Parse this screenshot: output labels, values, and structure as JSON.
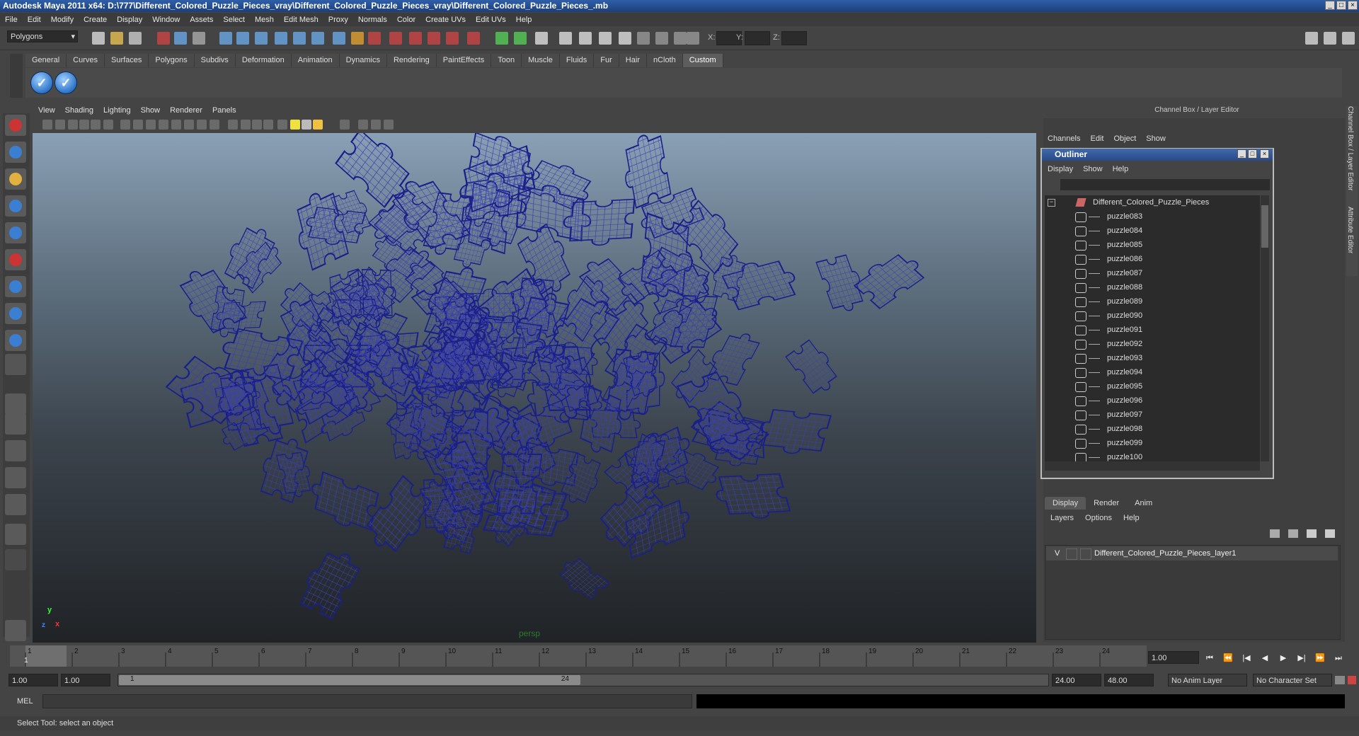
{
  "window": {
    "title": "Autodesk Maya 2011 x64: D:\\777\\Different_Colored_Puzzle_Pieces_vray\\Different_Colored_Puzzle_Pieces_vray\\Different_Colored_Puzzle_Pieces_.mb"
  },
  "menubar": [
    "File",
    "Edit",
    "Modify",
    "Create",
    "Display",
    "Window",
    "Assets",
    "Select",
    "Mesh",
    "Edit Mesh",
    "Proxy",
    "Normals",
    "Color",
    "Create UVs",
    "Edit UVs",
    "Help"
  ],
  "toolbar": {
    "mode_select": "Polygons",
    "coord_labels": [
      "X:",
      "Y:",
      "Z:"
    ]
  },
  "shelf": {
    "tabs": [
      "General",
      "Curves",
      "Surfaces",
      "Polygons",
      "Subdivs",
      "Deformation",
      "Animation",
      "Dynamics",
      "Rendering",
      "PaintEffects",
      "Toon",
      "Muscle",
      "Fluids",
      "Fur",
      "Hair",
      "nCloth",
      "Custom"
    ],
    "active_tab": "Custom",
    "icon_glyph": "✓"
  },
  "viewport": {
    "menu": [
      "View",
      "Shading",
      "Lighting",
      "Show",
      "Renderer",
      "Panels"
    ],
    "camera_label": "persp",
    "axis": {
      "x": "x",
      "y": "y",
      "z": "z"
    },
    "wire_color": "#1a1f8a"
  },
  "channel_box": {
    "title": "Channel Box / Layer Editor",
    "menu": [
      "Channels",
      "Edit",
      "Object",
      "Show"
    ],
    "side_tabs": [
      "Channel Box / Layer Editor",
      "Attribute Editor"
    ]
  },
  "outliner": {
    "title": "Outliner",
    "menu": [
      "Display",
      "Show",
      "Help"
    ],
    "root": "Different_Colored_Puzzle_Pieces",
    "items": [
      "puzzle083",
      "puzzle084",
      "puzzle085",
      "puzzle086",
      "puzzle087",
      "puzzle088",
      "puzzle089",
      "puzzle090",
      "puzzle091",
      "puzzle092",
      "puzzle093",
      "puzzle094",
      "puzzle095",
      "puzzle096",
      "puzzle097",
      "puzzle098",
      "puzzle099",
      "puzzle100"
    ]
  },
  "layer_editor": {
    "tabs": [
      "Display",
      "Render",
      "Anim"
    ],
    "active_tab": "Display",
    "menu": [
      "Layers",
      "Options",
      "Help"
    ],
    "layers": [
      {
        "visible": "V",
        "name": "Different_Colored_Puzzle_Pieces_layer1"
      }
    ]
  },
  "timeline": {
    "ticks": [
      "1",
      "2",
      "3",
      "4",
      "5",
      "6",
      "7",
      "8",
      "9",
      "10",
      "11",
      "12",
      "13",
      "14",
      "15",
      "16",
      "17",
      "18",
      "19",
      "20",
      "21",
      "22",
      "23",
      "24"
    ],
    "current_frame_marker": "1",
    "current_time": "1.00"
  },
  "range": {
    "start_time": "1.00",
    "playback_start": "1.00",
    "range_start_label": "1",
    "range_end_label": "24",
    "playback_end": "24.00",
    "end_time": "48.00",
    "anim_layer": "No Anim Layer",
    "character_set": "No Character Set"
  },
  "command_line": {
    "label": "MEL"
  },
  "help_line": "Select Tool: select an object"
}
